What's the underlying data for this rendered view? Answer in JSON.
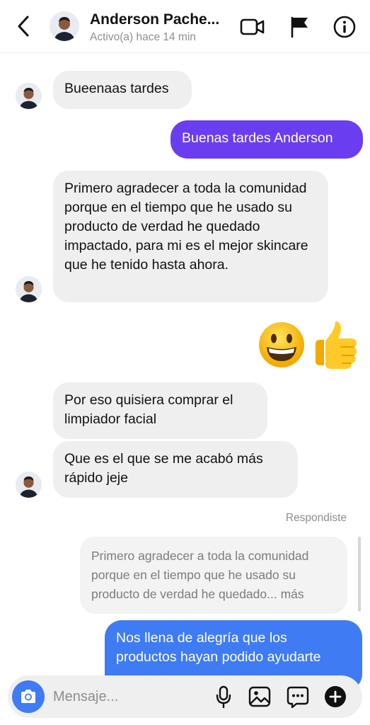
{
  "header": {
    "name": "Anderson Pache...",
    "status": "Activo(a) hace 14 min"
  },
  "messages": {
    "m1": "Bueenaas tardes",
    "m2": "Buenas tardes Anderson",
    "m3": "Primero agradecer a toda la comunidad porque en el tiempo que he usado su producto de verdad he quedado impactado, para mi es el mejor skincare que he tenido hasta ahora.",
    "m5": "Por eso quisiera comprar el limpiador facial",
    "m6": "Que es el que se me acabó más rápido jeje",
    "reply_label": "Respondiste",
    "quote": "Primero agradecer a toda la comunidad porque en el tiempo que he usado su producto de verdad he quedado... más",
    "m7": "Nos llena de alegría que los productos hayan podido ayudarte"
  },
  "composer": {
    "placeholder": "Mensaje..."
  },
  "colors": {
    "outgoing_purple": "#6a3ef0",
    "outgoing_blue": "#3f7bf3",
    "incoming": "#efefef"
  },
  "icons": [
    "back-icon",
    "video-call-icon",
    "flag-icon",
    "info-icon",
    "camera-icon",
    "microphone-icon",
    "image-icon",
    "sticker-icon",
    "plus-icon",
    "grinning-face-emoji",
    "thumbs-up-emoji"
  ]
}
